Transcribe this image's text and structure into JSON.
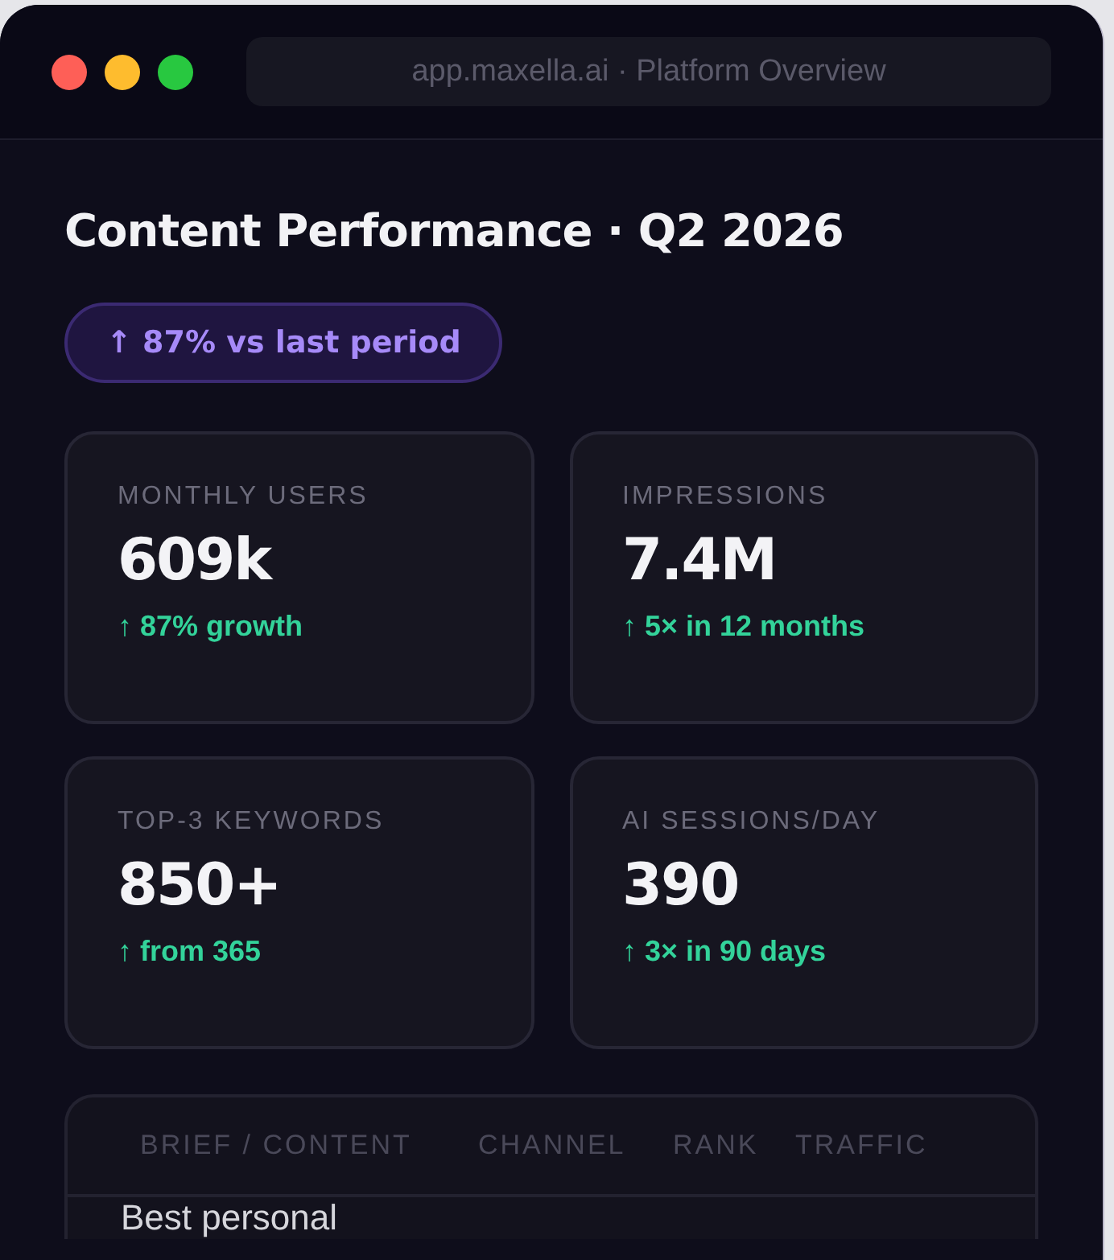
{
  "window": {
    "address": "app.maxella.ai · Platform Overview"
  },
  "title": "Content Performance · Q2 2026",
  "badge": "↑ 87% vs last period",
  "stats": [
    {
      "label": "MONTHLY USERS",
      "value": "609k",
      "change": "↑ 87% growth"
    },
    {
      "label": "IMPRESSIONS",
      "value": "7.4M",
      "change": "↑ 5× in 12 months"
    },
    {
      "label": "TOP-3 KEYWORDS",
      "value": "850+",
      "change": "↑ from 365"
    },
    {
      "label": "AI SESSIONS/DAY",
      "value": "390",
      "change": "↑ 3× in 90 days"
    }
  ],
  "table": {
    "columns": [
      "BRIEF / CONTENT",
      "CHANNEL",
      "RANK",
      "TRAFFIC"
    ],
    "rows": [
      [
        "Best personal"
      ]
    ]
  }
}
